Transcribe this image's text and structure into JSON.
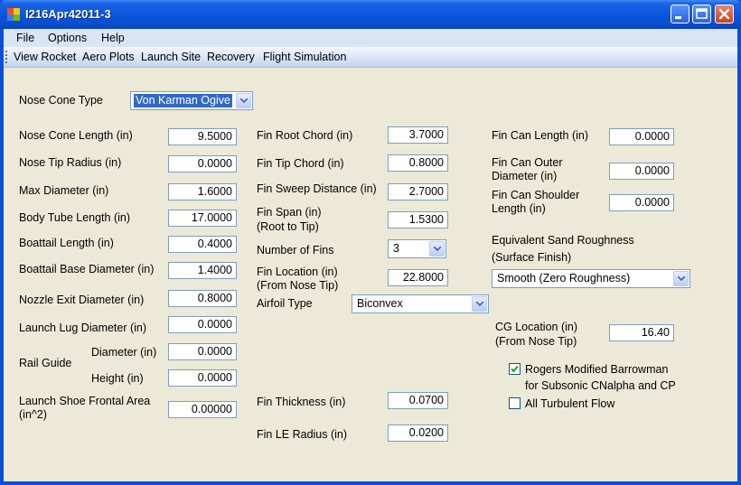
{
  "window": {
    "title": "I216Apr42011-3"
  },
  "menu": [
    "File",
    "Options",
    "Help"
  ],
  "toolbar": [
    "View Rocket",
    "Aero Plots",
    "Launch Site",
    "Recovery",
    "Flight Simulation"
  ],
  "nose_cone": {
    "label": "Nose Cone Type",
    "value": "Von Karman Ogive"
  },
  "col1": {
    "nose_cone_length": {
      "label": "Nose Cone Length (in)",
      "value": "9.5000"
    },
    "nose_tip_radius": {
      "label": "Nose Tip Radius (in)",
      "value": "0.0000"
    },
    "max_diameter": {
      "label": "Max Diameter (in)",
      "value": "1.6000"
    },
    "body_tube_length": {
      "label": "Body Tube Length (in)",
      "value": "17.0000"
    },
    "boattail_length": {
      "label": "Boattail Length (in)",
      "value": "0.4000"
    },
    "boattail_base_diameter": {
      "label": "Boattail Base Diameter (in)",
      "value": "1.4000"
    },
    "nozzle_exit_diameter": {
      "label": "Nozzle Exit Diameter (in)",
      "value": "0.8000"
    },
    "launch_lug_diameter": {
      "label": "Launch Lug Diameter (in)",
      "value": "0.0000"
    },
    "rail_guide": {
      "label": "Rail Guide",
      "diameter_label": "Diameter (in)",
      "diameter_value": "0.0000",
      "height_label": "Height (in)",
      "height_value": "0.0000"
    },
    "launch_shoe": {
      "label_line1": "Launch Shoe Frontal Area",
      "label_line2": "(in^2)",
      "value": "0.00000"
    }
  },
  "col2": {
    "fin_root_chord": {
      "label": "Fin Root Chord (in)",
      "value": "3.7000"
    },
    "fin_tip_chord": {
      "label": "Fin Tip Chord (in)",
      "value": "0.8000"
    },
    "fin_sweep_distance": {
      "label": "Fin Sweep Distance (in)",
      "value": "2.7000"
    },
    "fin_span": {
      "label_line1": "Fin Span (in)",
      "label_line2": "(Root to Tip)",
      "value": "1.5300"
    },
    "number_of_fins": {
      "label": "Number of Fins",
      "value": "3"
    },
    "fin_location": {
      "label_line1": "Fin Location (in)",
      "label_line2": "(From Nose Tip)",
      "value": "22.8000"
    },
    "airfoil_type": {
      "label": "Airfoil Type",
      "value": "Biconvex"
    },
    "fin_thickness": {
      "label": "Fin Thickness (in)",
      "value": "0.0700"
    },
    "fin_le_radius": {
      "label": "Fin LE Radius (in)",
      "value": "0.0200"
    }
  },
  "col3": {
    "fin_can_length": {
      "label": "Fin Can Length (in)",
      "value": "0.0000"
    },
    "fin_can_outer_diameter": {
      "label_line1": "Fin Can Outer",
      "label_line2": "Diameter (in)",
      "value": "0.0000"
    },
    "fin_can_shoulder_length": {
      "label_line1": "Fin Can Shoulder",
      "label_line2": "Length (in)",
      "value": "0.0000"
    },
    "roughness": {
      "label_line1": "Equivalent Sand Roughness",
      "label_line2": "(Surface Finish)",
      "value": "Smooth (Zero Roughness)"
    },
    "cg_location": {
      "label_line1": "CG Location (in)",
      "label_line2": "(From Nose Tip)",
      "value": "16.40"
    },
    "rogers": {
      "label_line1": "Rogers Modified Barrowman",
      "label_line2": "for Subsonic CNalpha and CP",
      "checked": true
    },
    "turbulent": {
      "label": "All Turbulent Flow",
      "checked": false
    }
  },
  "colors": {
    "titlebar": "#0a4fd6",
    "selection": "#316ac5",
    "form_bg": "#ece9d8"
  }
}
